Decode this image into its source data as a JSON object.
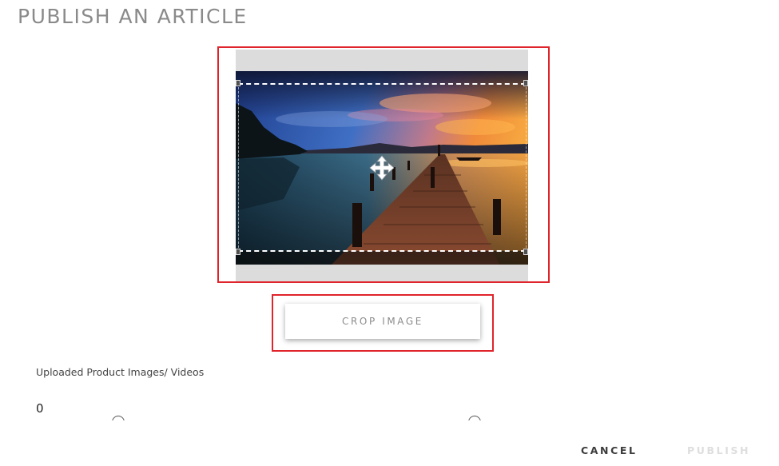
{
  "page": {
    "title": "PUBLISH AN ARTICLE"
  },
  "cropper": {
    "image_subject": "sunset-pier-lake-image",
    "move_handle_icon": "move-arrows-icon",
    "crop_button_label": "CROP IMAGE"
  },
  "uploads": {
    "label": "Uploaded Product Images/ Videos",
    "count": "0"
  },
  "actions": {
    "cancel_label": "CANCEL",
    "publish_label": "PUBLISH"
  },
  "colors": {
    "highlight": "#e0242b",
    "title": "#8a8a8a",
    "publish_disabled": "#dedede",
    "canvas_background": "#dcdcdc"
  }
}
